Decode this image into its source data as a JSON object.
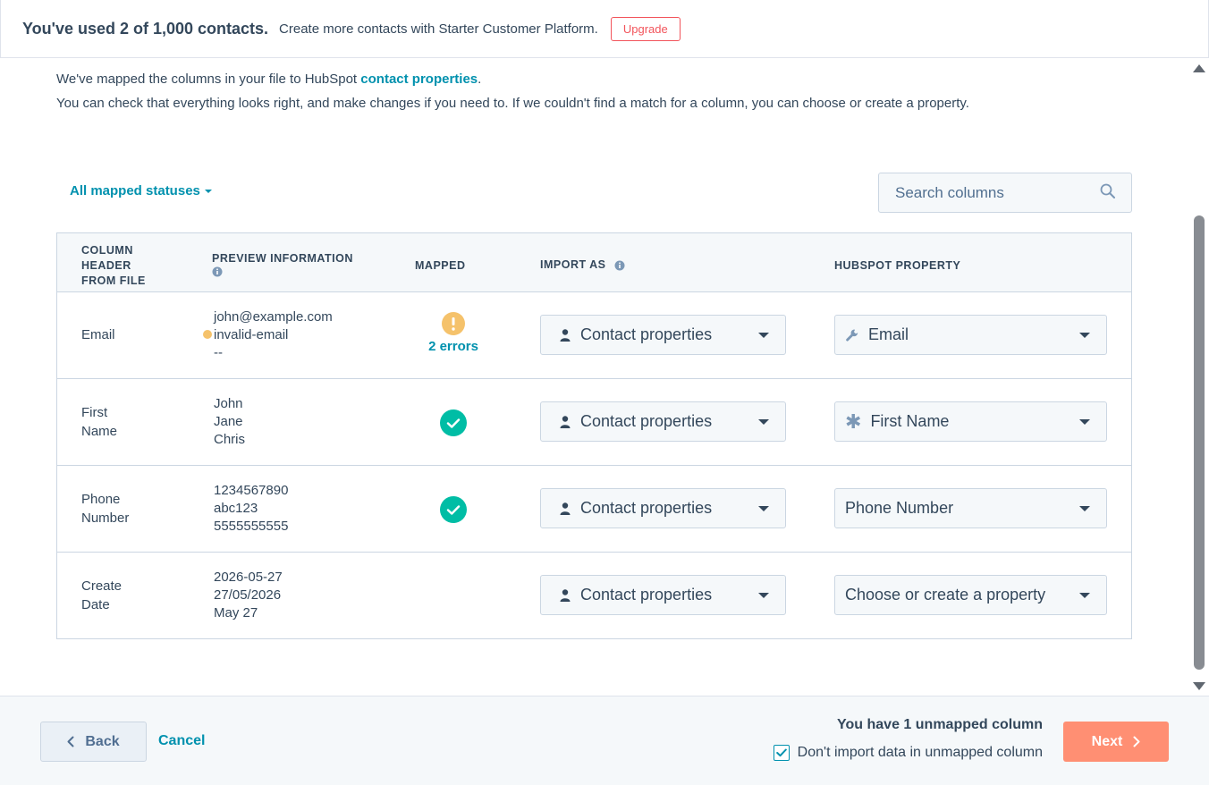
{
  "banner": {
    "title": "You've used 2 of 1,000 contacts.",
    "text": "Create more contacts with Starter Customer Platform.",
    "upgrade_label": "Upgrade"
  },
  "intro": {
    "line1_prefix": "We've mapped the columns in your file to HubSpot ",
    "line1_link": "contact properties",
    "line1_suffix": ".",
    "line2": "You can check that everything looks right, and make changes if you need to. If we couldn't find a match for a column, you can choose or create a property."
  },
  "filter": {
    "label": "All mapped statuses"
  },
  "search": {
    "placeholder": "Search columns"
  },
  "table": {
    "headers": {
      "column_header": [
        "COLUMN",
        "HEADER",
        "FROM FILE"
      ],
      "preview": "PREVIEW INFORMATION",
      "mapped": "MAPPED",
      "import_as": "IMPORT AS",
      "hubspot_property": "HUBSPOT PROPERTY"
    },
    "rows": [
      {
        "column": [
          "Email"
        ],
        "preview": [
          "john@example.com",
          "invalid-email",
          "--"
        ],
        "mapped_status": "warning",
        "mapped_text": "2 errors",
        "import_as": "Contact properties",
        "property": "Email",
        "property_icon": "wrench-icon"
      },
      {
        "column": [
          "First",
          "Name"
        ],
        "preview": [
          "John",
          "Jane",
          "Chris"
        ],
        "mapped_status": "success",
        "import_as": "Contact properties",
        "property": "First Name",
        "property_icon": "asterisk-icon"
      },
      {
        "column": [
          "Phone",
          "Number"
        ],
        "preview": [
          "1234567890",
          "abc123",
          "5555555555"
        ],
        "mapped_status": "success",
        "import_as": "Contact properties",
        "property": "Phone Number",
        "property_icon": ""
      },
      {
        "column": [
          "Create",
          "Date"
        ],
        "preview": [
          "2026-05-27",
          "27/05/2026",
          "May 27"
        ],
        "mapped_status": "none",
        "import_as": "Contact properties",
        "property": "Choose or create a property",
        "property_icon": ""
      }
    ]
  },
  "footer": {
    "back_label": "Back",
    "cancel_label": "Cancel",
    "unmapped_text": "You have 1 unmapped column",
    "checkbox_label": "Don't import data in unmapped column",
    "checkbox_checked": true,
    "next_label": "Next"
  },
  "colors": {
    "accent": "#0091ae",
    "success": "#00bda5",
    "warning": "#f5c26b",
    "next_button": "#ff8f73",
    "upgrade": "#f2545b"
  }
}
